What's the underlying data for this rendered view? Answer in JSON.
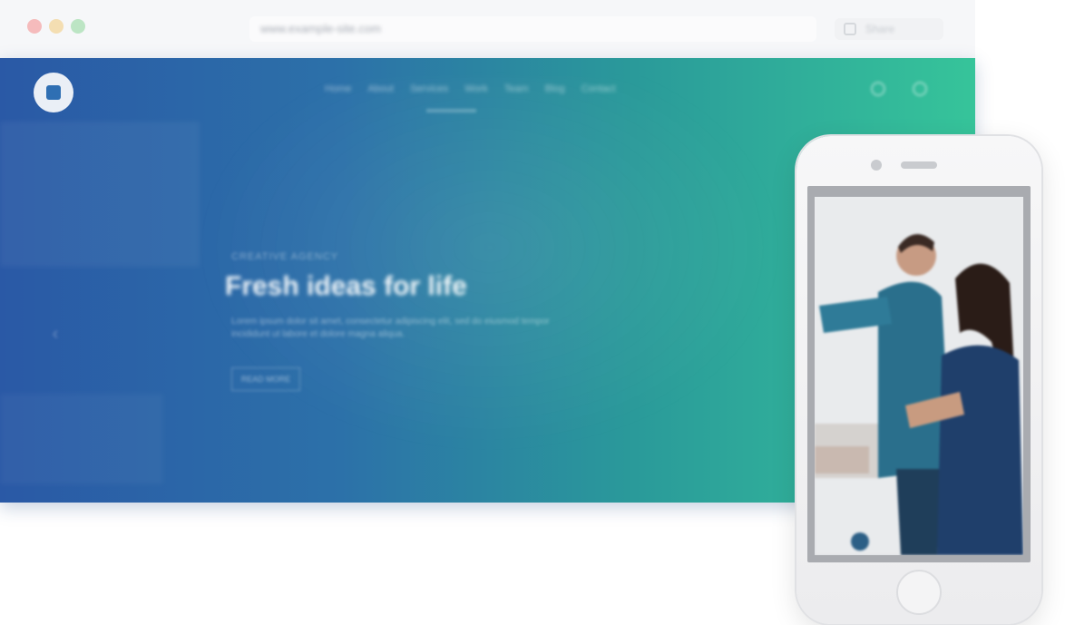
{
  "browser": {
    "url": "www.example-site.com",
    "share_label": "Share"
  },
  "hero": {
    "nav_items": [
      "Home",
      "About",
      "Services",
      "Work",
      "Team",
      "Blog",
      "Contact"
    ],
    "eyebrow": "CREATIVE AGENCY",
    "title": "Fresh ideas for life",
    "description": "Lorem ipsum dolor sit amet, consectetur adipiscing elit, sed do eiusmod tempor incididunt ut labore et dolore magna aliqua.",
    "cta_label": "READ MORE",
    "prev_arrow": "‹"
  },
  "colors": {
    "hero_start": "#2a59a6",
    "hero_end": "#36c49a",
    "phone_body": "#f7f7f8"
  },
  "icons": {
    "logo": "logo-icon",
    "search": "search-icon",
    "menu": "menu-icon",
    "share": "share-icon"
  }
}
